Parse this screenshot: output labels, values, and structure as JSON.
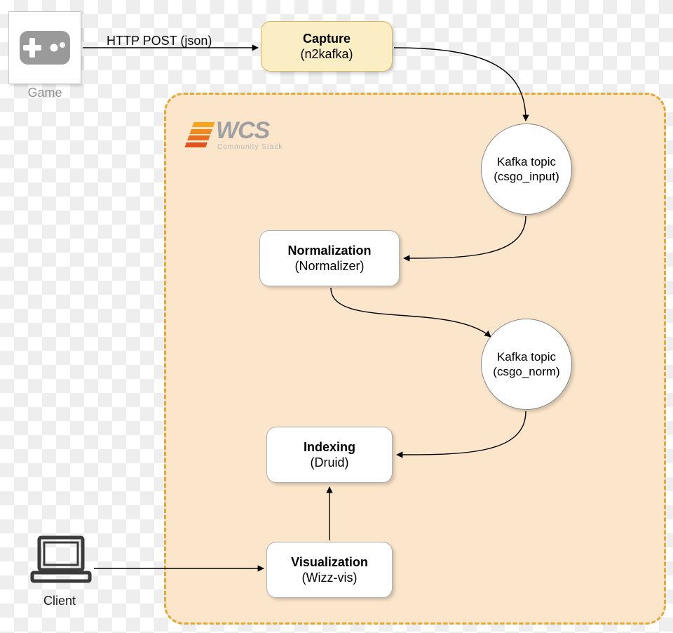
{
  "external": {
    "game_label": "Game",
    "client_label": "Client"
  },
  "edges": {
    "http_post": "HTTP POST (json)"
  },
  "logo": {
    "main": "WCS",
    "tagline": "Community Stack"
  },
  "nodes": {
    "capture": {
      "title": "Capture",
      "sub": "(n2kafka)"
    },
    "topic_input": {
      "line1": "Kafka topic",
      "line2": "(csgo_input)"
    },
    "normalization": {
      "title": "Normalization",
      "sub": "(Normalizer)"
    },
    "topic_norm": {
      "line1": "Kafka topic",
      "line2": "(csgo_norm)"
    },
    "indexing": {
      "title": "Indexing",
      "sub": "(Druid)"
    },
    "visualization": {
      "title": "Visualization",
      "sub": "(Wizz-vis)"
    }
  }
}
